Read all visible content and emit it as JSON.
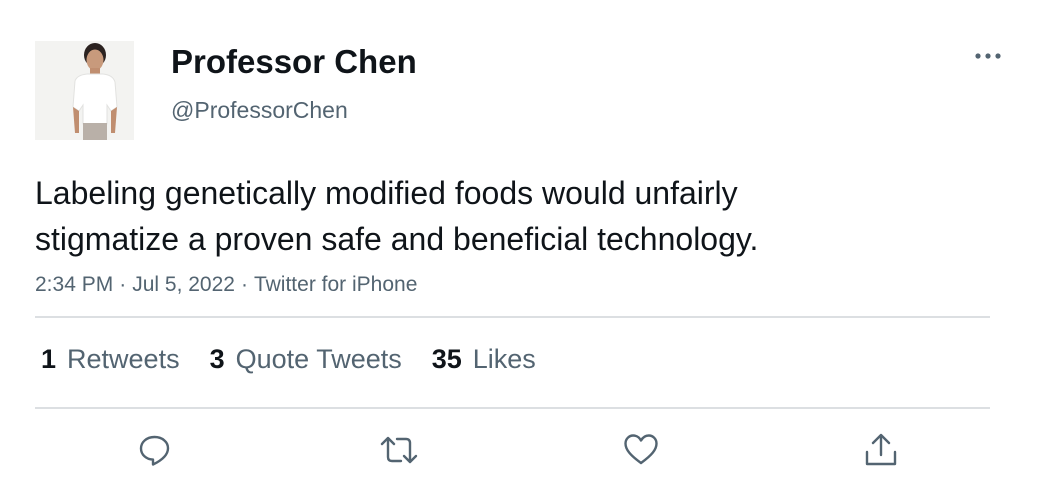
{
  "author": {
    "display_name": "Professor Chen",
    "handle": "@ProfessorChen"
  },
  "tweet": {
    "text_lines": [
      "Labeling genetically modified foods would unfairly",
      "stigmatize a proven safe and beneficial technology."
    ],
    "time": "2:34 PM",
    "separator": "·",
    "date": "Jul 5, 2022",
    "source": "Twitter for iPhone"
  },
  "stats": {
    "retweets": {
      "count": "1",
      "label": "Retweets"
    },
    "quote_tweets": {
      "count": "3",
      "label": "Quote Tweets"
    },
    "likes": {
      "count": "35",
      "label": "Likes"
    }
  },
  "icons": {
    "more": "more-icon",
    "reply": "reply-icon",
    "retweet": "retweet-icon",
    "like": "like-icon",
    "share": "share-icon"
  },
  "colors": {
    "text_primary": "#0f1419",
    "text_secondary": "#536471",
    "divider": "#dcdfe2",
    "icon": "#536471"
  }
}
